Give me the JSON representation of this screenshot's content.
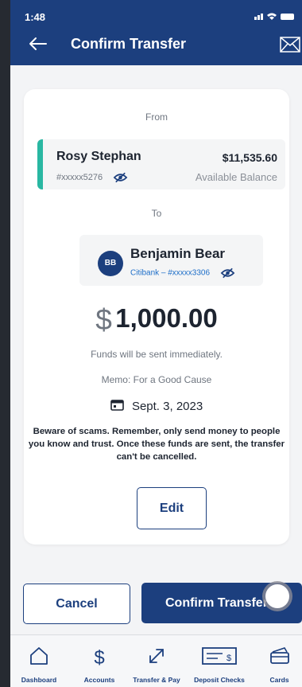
{
  "status": {
    "time": "1:48",
    "icons": "📶 ▬"
  },
  "header": {
    "title": "Confirm Transfer"
  },
  "from": {
    "label": "From",
    "name": "Rosy Stephan",
    "account": "#xxxxx5276",
    "balance": "$11,535.60",
    "balance_label": "Available Balance"
  },
  "to": {
    "label": "To",
    "initials": "BB",
    "name": "Benjamin Bear",
    "account": "Citibank – #xxxxx3306"
  },
  "amount": {
    "symbol": "$",
    "value": "1,000.00"
  },
  "funds_note": "Funds will be sent immediately.",
  "memo": "Memo: For a Good Cause",
  "date": "Sept. 3, 2023",
  "warning": "Beware of scams. Remember, only send money to people you know and trust. Once these funds are sent, the transfer can't be cancelled.",
  "buttons": {
    "edit": "Edit",
    "cancel": "Cancel",
    "confirm": "Confirm Transfer"
  },
  "tabs": [
    {
      "label": "Dashboard",
      "icon": "home-icon"
    },
    {
      "label": "Accounts",
      "icon": "dollar-icon"
    },
    {
      "label": "Transfer & Pay",
      "icon": "transfer-icon"
    },
    {
      "label": "Deposit Checks",
      "icon": "check-icon"
    },
    {
      "label": "Cards",
      "icon": "cards-icon"
    }
  ],
  "colors": {
    "brand": "#1c3f7e",
    "accent": "#29b7a2",
    "link": "#1d6ec8"
  }
}
